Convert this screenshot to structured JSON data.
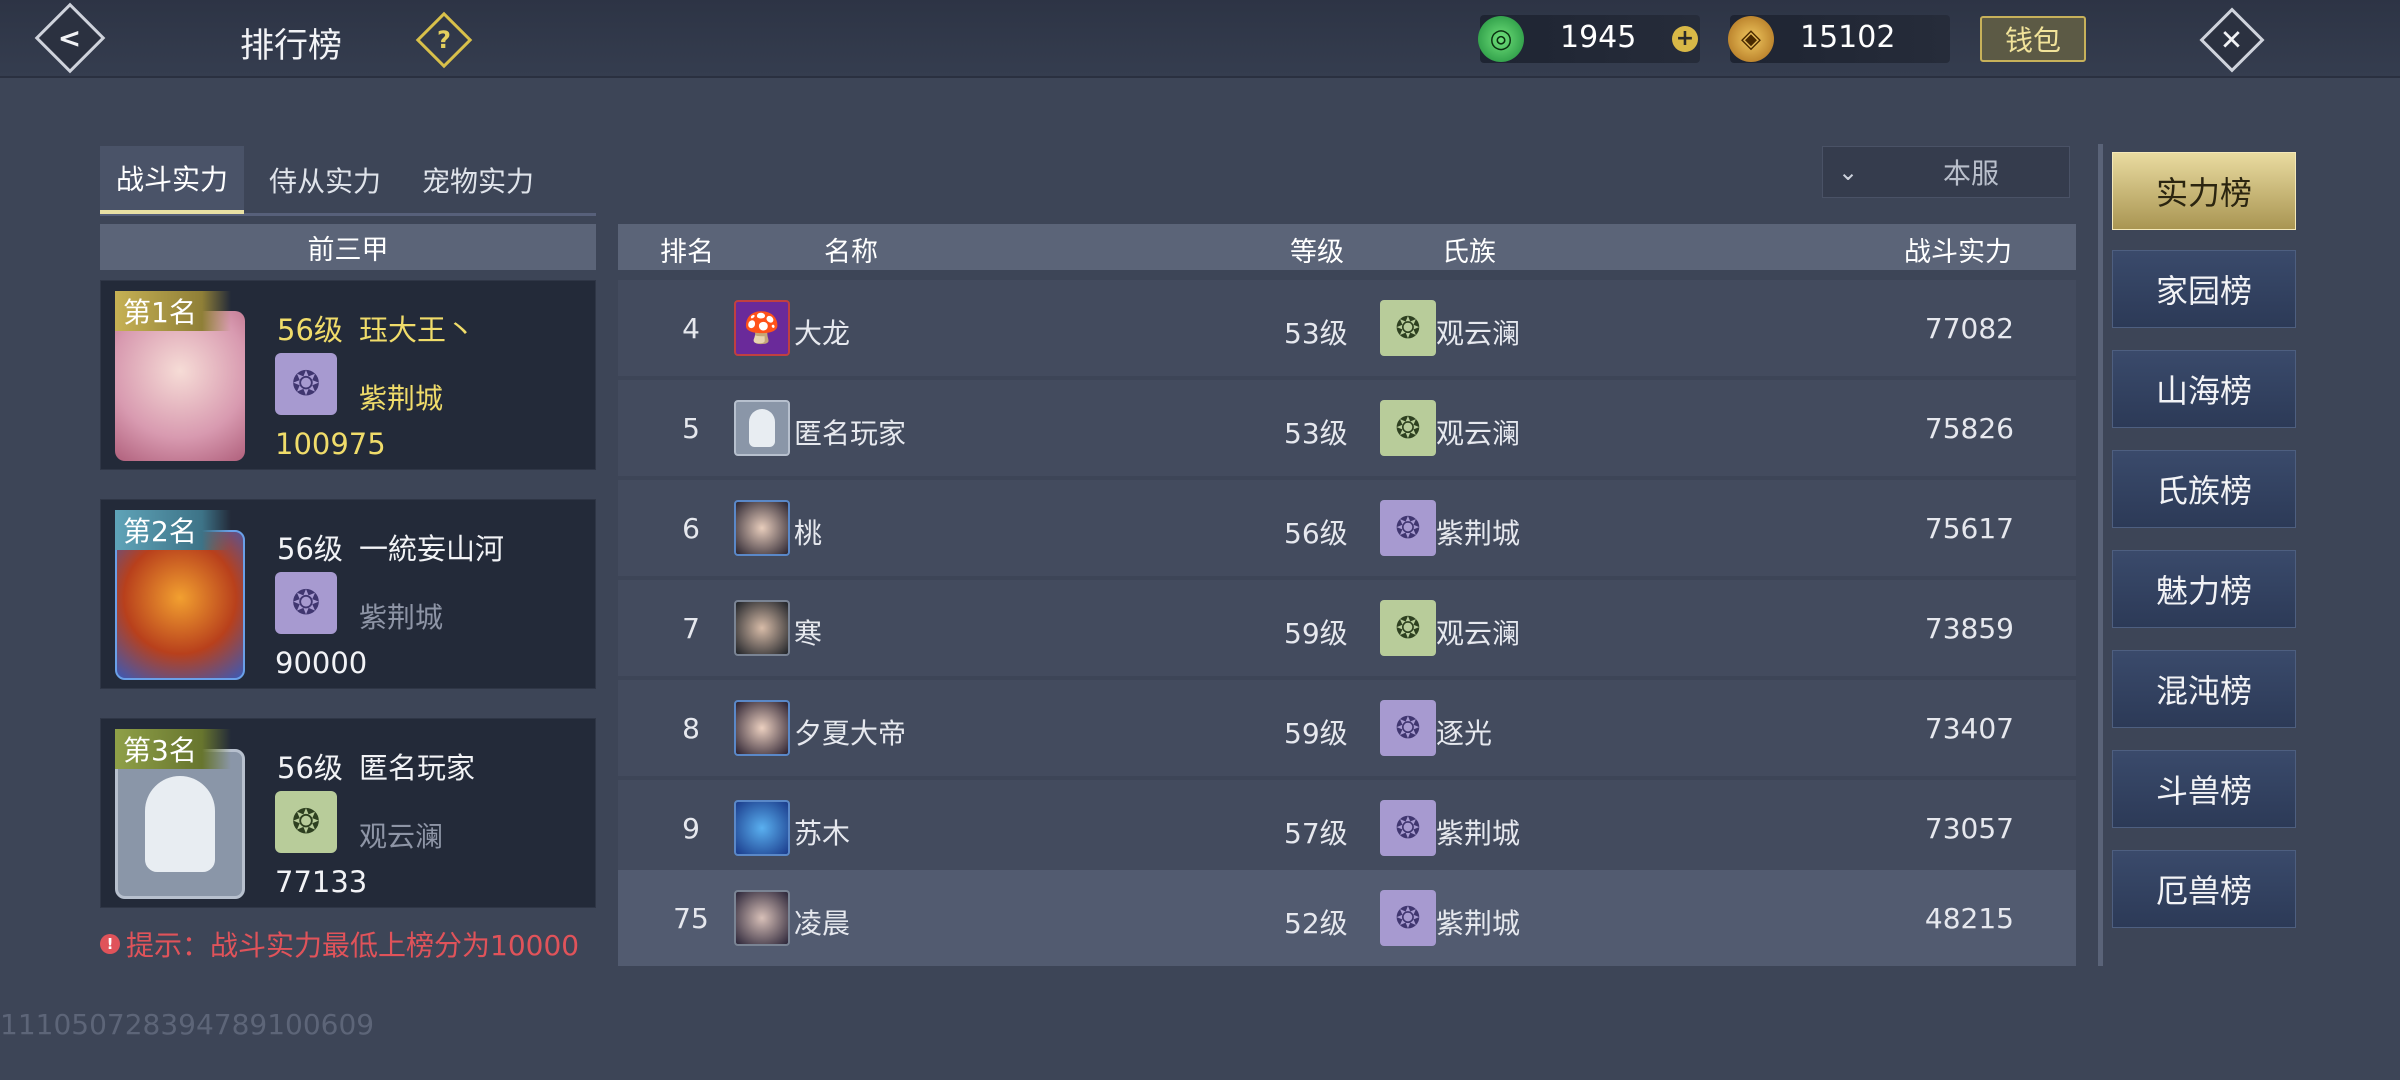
{
  "header": {
    "title": "排行榜",
    "help_icon": "question-mark-icon",
    "currency": [
      {
        "icon": "jade-icon",
        "value": "1945"
      },
      {
        "icon": "gold-ingot-icon",
        "value": "15102"
      }
    ],
    "wallet_label": "钱包"
  },
  "tabs": [
    {
      "label": "战斗实力",
      "active": true
    },
    {
      "label": "侍从实力",
      "active": false
    },
    {
      "label": "宠物实力",
      "active": false
    }
  ],
  "server_select": {
    "value": "本服"
  },
  "top3": {
    "title": "前三甲",
    "entries": [
      {
        "rank": "第1名",
        "level": "56级",
        "name": "珏大王丶",
        "clan": "紫荆城",
        "power": "100975",
        "color": "#f0dc6a"
      },
      {
        "rank": "第2名",
        "level": "56级",
        "name": "一統妄山河",
        "clan": "紫荆城",
        "power": "90000",
        "color": "#ffffff"
      },
      {
        "rank": "第3名",
        "level": "56级",
        "name": "匿名玩家",
        "clan": "观云澜",
        "power": "77133",
        "color": "#ffffff"
      }
    ]
  },
  "tip": "提示：战斗实力最低上榜分为10000",
  "list": {
    "headers": {
      "rank": "排名",
      "name": "名称",
      "level": "等级",
      "clan": "氏族",
      "power": "战斗实力"
    },
    "rows": [
      {
        "rank": "4",
        "name": "大龙",
        "level": "53级",
        "clan": "观云澜",
        "power": "77082"
      },
      {
        "rank": "5",
        "name": "匿名玩家",
        "level": "53级",
        "clan": "观云澜",
        "power": "75826"
      },
      {
        "rank": "6",
        "name": "桃",
        "level": "56级",
        "clan": "紫荆城",
        "power": "75617"
      },
      {
        "rank": "7",
        "name": "寒",
        "level": "59级",
        "clan": "观云澜",
        "power": "73859"
      },
      {
        "rank": "8",
        "name": "夕夏大帝",
        "level": "59级",
        "clan": "逐光",
        "power": "73407"
      },
      {
        "rank": "9",
        "name": "苏木",
        "level": "57级",
        "clan": "紫荆城",
        "power": "73057"
      },
      {
        "rank": "75",
        "name": "凌晨",
        "level": "52级",
        "clan": "紫荆城",
        "power": "48215"
      }
    ]
  },
  "sidebar": [
    {
      "label": "实力榜",
      "active": true
    },
    {
      "label": "家园榜",
      "active": false
    },
    {
      "label": "山海榜",
      "active": false
    },
    {
      "label": "氏族榜",
      "active": false
    },
    {
      "label": "魅力榜",
      "active": false
    },
    {
      "label": "混沌榜",
      "active": false
    },
    {
      "label": "斗兽榜",
      "active": false
    },
    {
      "label": "厄兽榜",
      "active": false
    }
  ],
  "uid": "1110507283947891006​09"
}
